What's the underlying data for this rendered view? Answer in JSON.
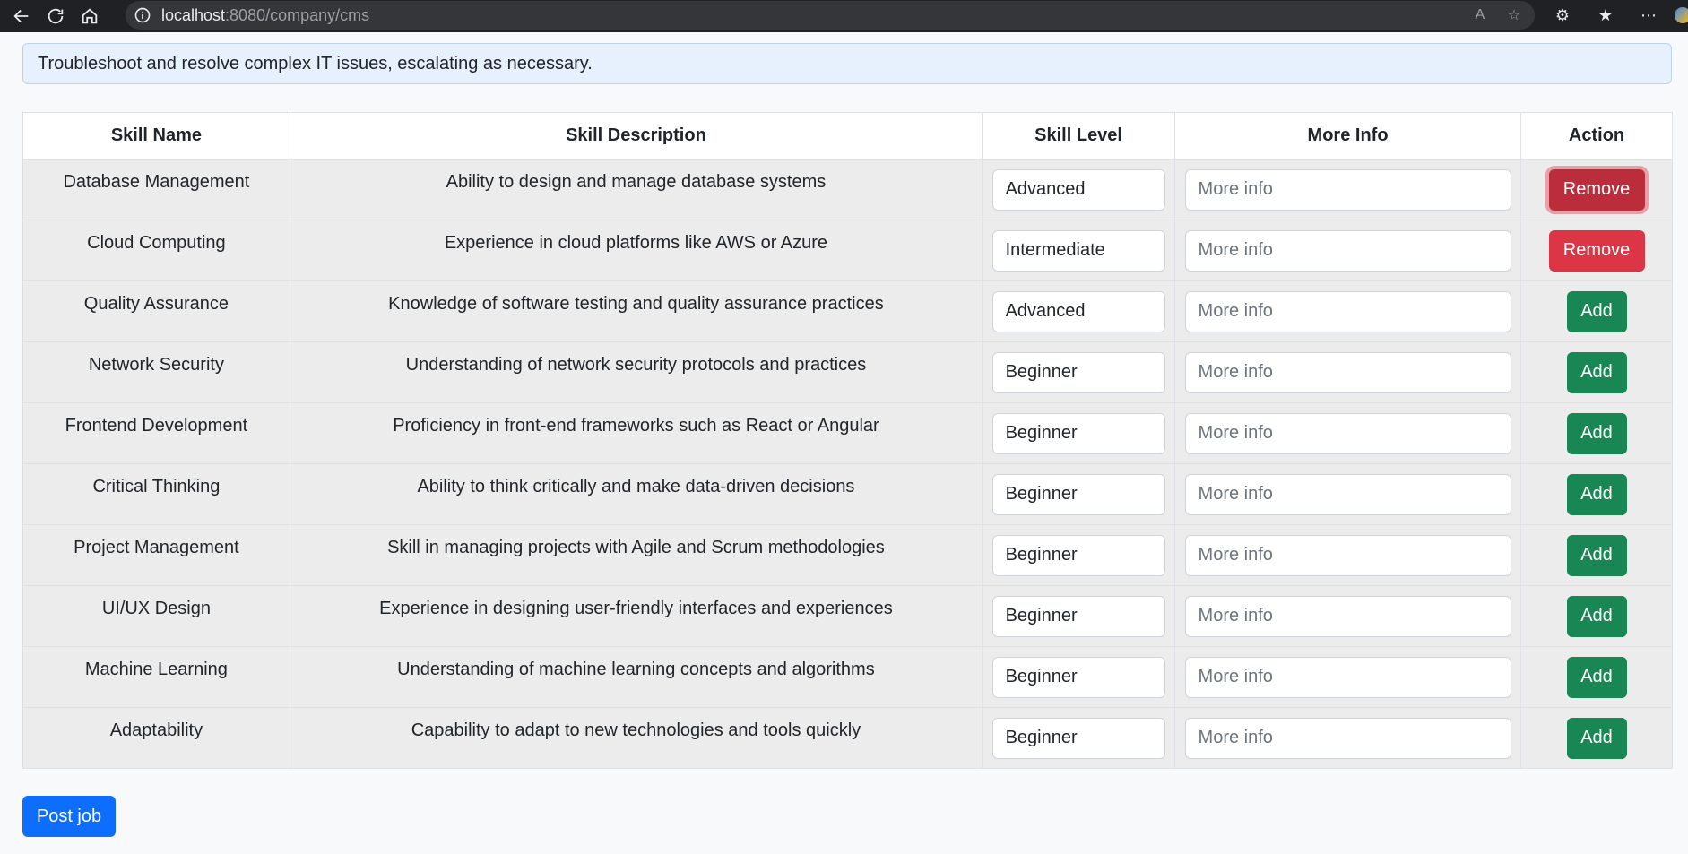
{
  "browser": {
    "url_host": "localhost",
    "url_rest": ":8080/company/cms"
  },
  "alert_text": "Troubleshoot and resolve complex IT issues, escalating as necessary.",
  "table": {
    "headers": [
      "Skill Name",
      "Skill Description",
      "Skill Level",
      "More Info",
      "Action"
    ],
    "rows": [
      {
        "name": "Database Management",
        "description": "Ability to design and manage database systems",
        "level": "Advanced",
        "more_info_placeholder": "More info",
        "action": "Remove"
      },
      {
        "name": "Cloud Computing",
        "description": "Experience in cloud platforms like AWS or Azure",
        "level": "Intermediate",
        "more_info_placeholder": "More info",
        "action": "Remove"
      },
      {
        "name": "Quality Assurance",
        "description": "Knowledge of software testing and quality assurance practices",
        "level": "Advanced",
        "more_info_placeholder": "More info",
        "action": "Add"
      },
      {
        "name": "Network Security",
        "description": "Understanding of network security protocols and practices",
        "level": "Beginner",
        "more_info_placeholder": "More info",
        "action": "Add"
      },
      {
        "name": "Frontend Development",
        "description": "Proficiency in front-end frameworks such as React or Angular",
        "level": "Beginner",
        "more_info_placeholder": "More info",
        "action": "Add"
      },
      {
        "name": "Critical Thinking",
        "description": "Ability to think critically and make data-driven decisions",
        "level": "Beginner",
        "more_info_placeholder": "More info",
        "action": "Add"
      },
      {
        "name": "Project Management",
        "description": "Skill in managing projects with Agile and Scrum methodologies",
        "level": "Beginner",
        "more_info_placeholder": "More info",
        "action": "Add"
      },
      {
        "name": "UI/UX Design",
        "description": "Experience in designing user-friendly interfaces and experiences",
        "level": "Beginner",
        "more_info_placeholder": "More info",
        "action": "Add"
      },
      {
        "name": "Machine Learning",
        "description": "Understanding of machine learning concepts and algorithms",
        "level": "Beginner",
        "more_info_placeholder": "More info",
        "action": "Add"
      },
      {
        "name": "Adaptability",
        "description": "Capability to adapt to new technologies and tools quickly",
        "level": "Beginner",
        "more_info_placeholder": "More info",
        "action": "Add"
      }
    ]
  },
  "post_job_label": "Post job",
  "colors": {
    "remove": "#dc3545",
    "add": "#198754",
    "primary": "#0d6efd"
  }
}
